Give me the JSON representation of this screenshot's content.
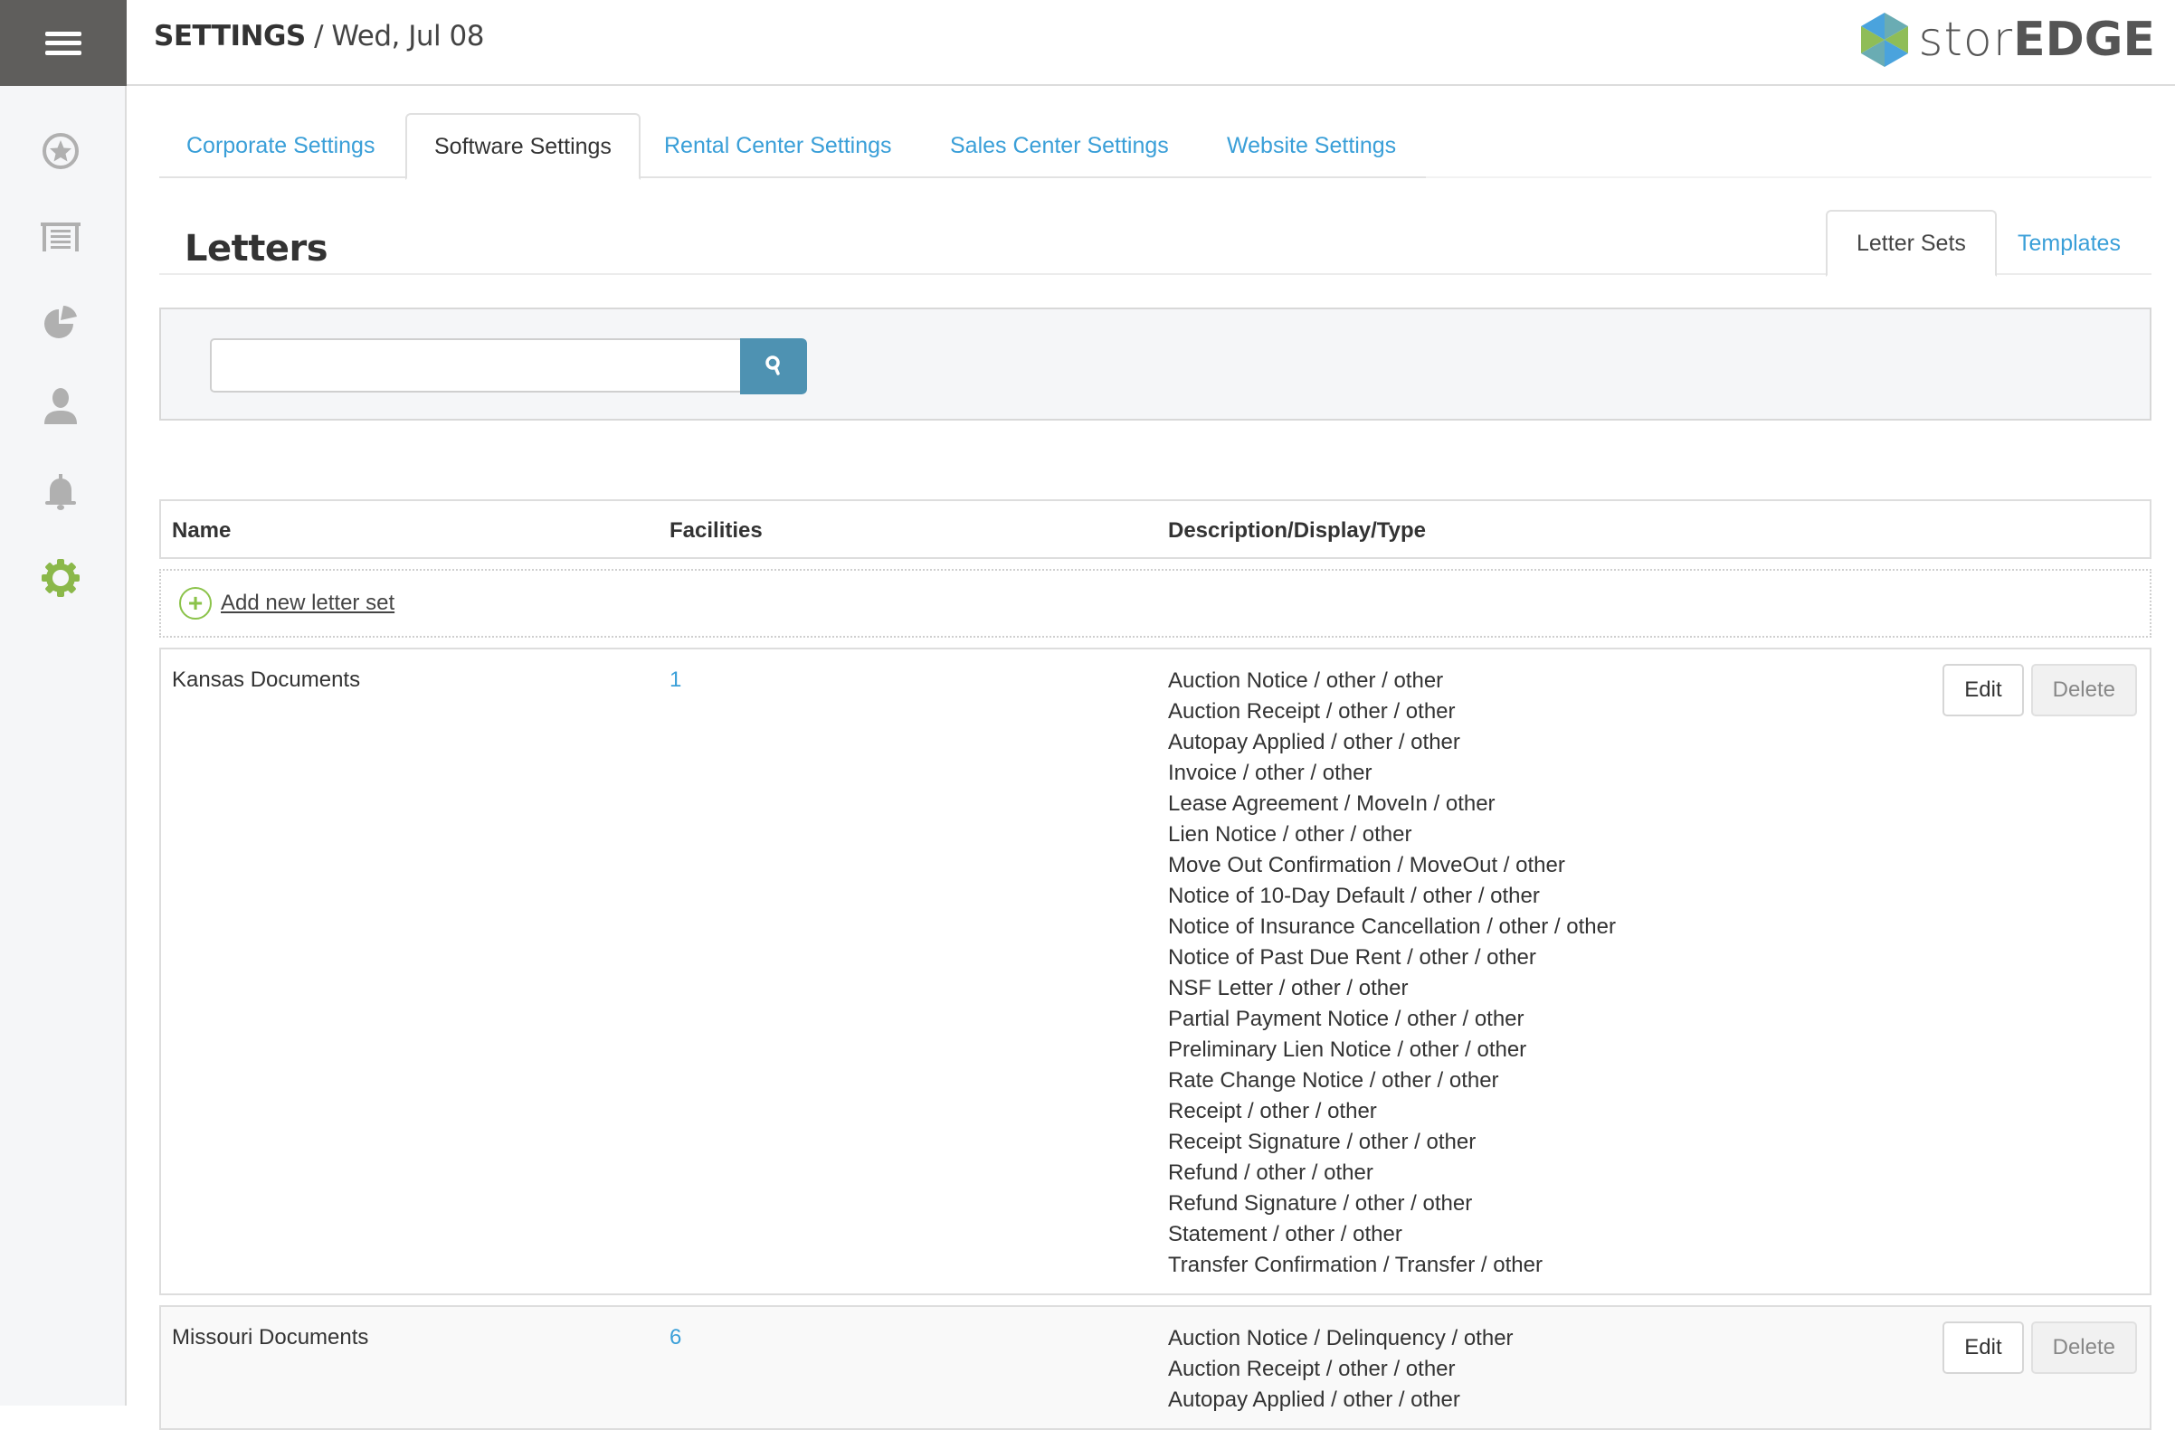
{
  "header": {
    "title": "SETTINGS",
    "separator": " / ",
    "date": "Wed, Jul 08",
    "logo_light": "stor",
    "logo_bold": "EDGE"
  },
  "sidebar": {
    "items": [
      {
        "name": "favorites",
        "icon": "star-circle-icon",
        "active": false
      },
      {
        "name": "storage-units",
        "icon": "garage-door-icon",
        "active": false
      },
      {
        "name": "reports",
        "icon": "pie-chart-icon",
        "active": false
      },
      {
        "name": "customers",
        "icon": "user-icon",
        "active": false
      },
      {
        "name": "notifications",
        "icon": "bell-icon",
        "active": false
      },
      {
        "name": "settings",
        "icon": "gear-icon",
        "active": true
      }
    ],
    "colors": {
      "icon": "#b0b0b0",
      "active": "#8bb84a"
    }
  },
  "main_tabs": [
    {
      "label": "Corporate Settings",
      "active": false
    },
    {
      "label": "Software Settings",
      "active": true
    },
    {
      "label": "Rental Center Settings",
      "active": false
    },
    {
      "label": "Sales Center Settings",
      "active": false
    },
    {
      "label": "Website Settings",
      "active": false
    }
  ],
  "section": {
    "title": "Letters",
    "subtabs": [
      {
        "label": "Letter Sets",
        "active": true
      },
      {
        "label": "Templates",
        "active": false
      }
    ]
  },
  "search": {
    "value": "",
    "placeholder": ""
  },
  "table": {
    "columns": [
      "Name",
      "Facilities",
      "Description/Display/Type"
    ],
    "add_label": " Add new letter set",
    "edit_label": "Edit",
    "delete_label": "Delete",
    "rows": [
      {
        "name": "Kansas Documents",
        "facilities": "1",
        "descriptions": [
          "Auction Notice / other / other",
          "Auction Receipt / other / other",
          "Autopay Applied / other / other",
          "Invoice / other / other",
          "Lease Agreement / MoveIn / other",
          "Lien Notice / other / other",
          "Move Out Confirmation / MoveOut / other",
          "Notice of 10-Day Default / other / other",
          "Notice of Insurance Cancellation / other / other",
          "Notice of Past Due Rent / other / other",
          "NSF Letter / other / other",
          "Partial Payment Notice / other / other",
          "Preliminary Lien Notice / other / other",
          "Rate Change Notice / other / other",
          "Receipt / other / other",
          "Receipt Signature / other / other",
          "Refund / other / other",
          "Refund Signature / other / other",
          "Statement / other / other",
          "Transfer Confirmation / Transfer / other"
        ]
      },
      {
        "name": "Missouri Documents",
        "facilities": "6",
        "descriptions": [
          "Auction Notice / Delinquency / other",
          "Auction Receipt / other / other",
          "Autopay Applied / other / other"
        ]
      }
    ]
  }
}
